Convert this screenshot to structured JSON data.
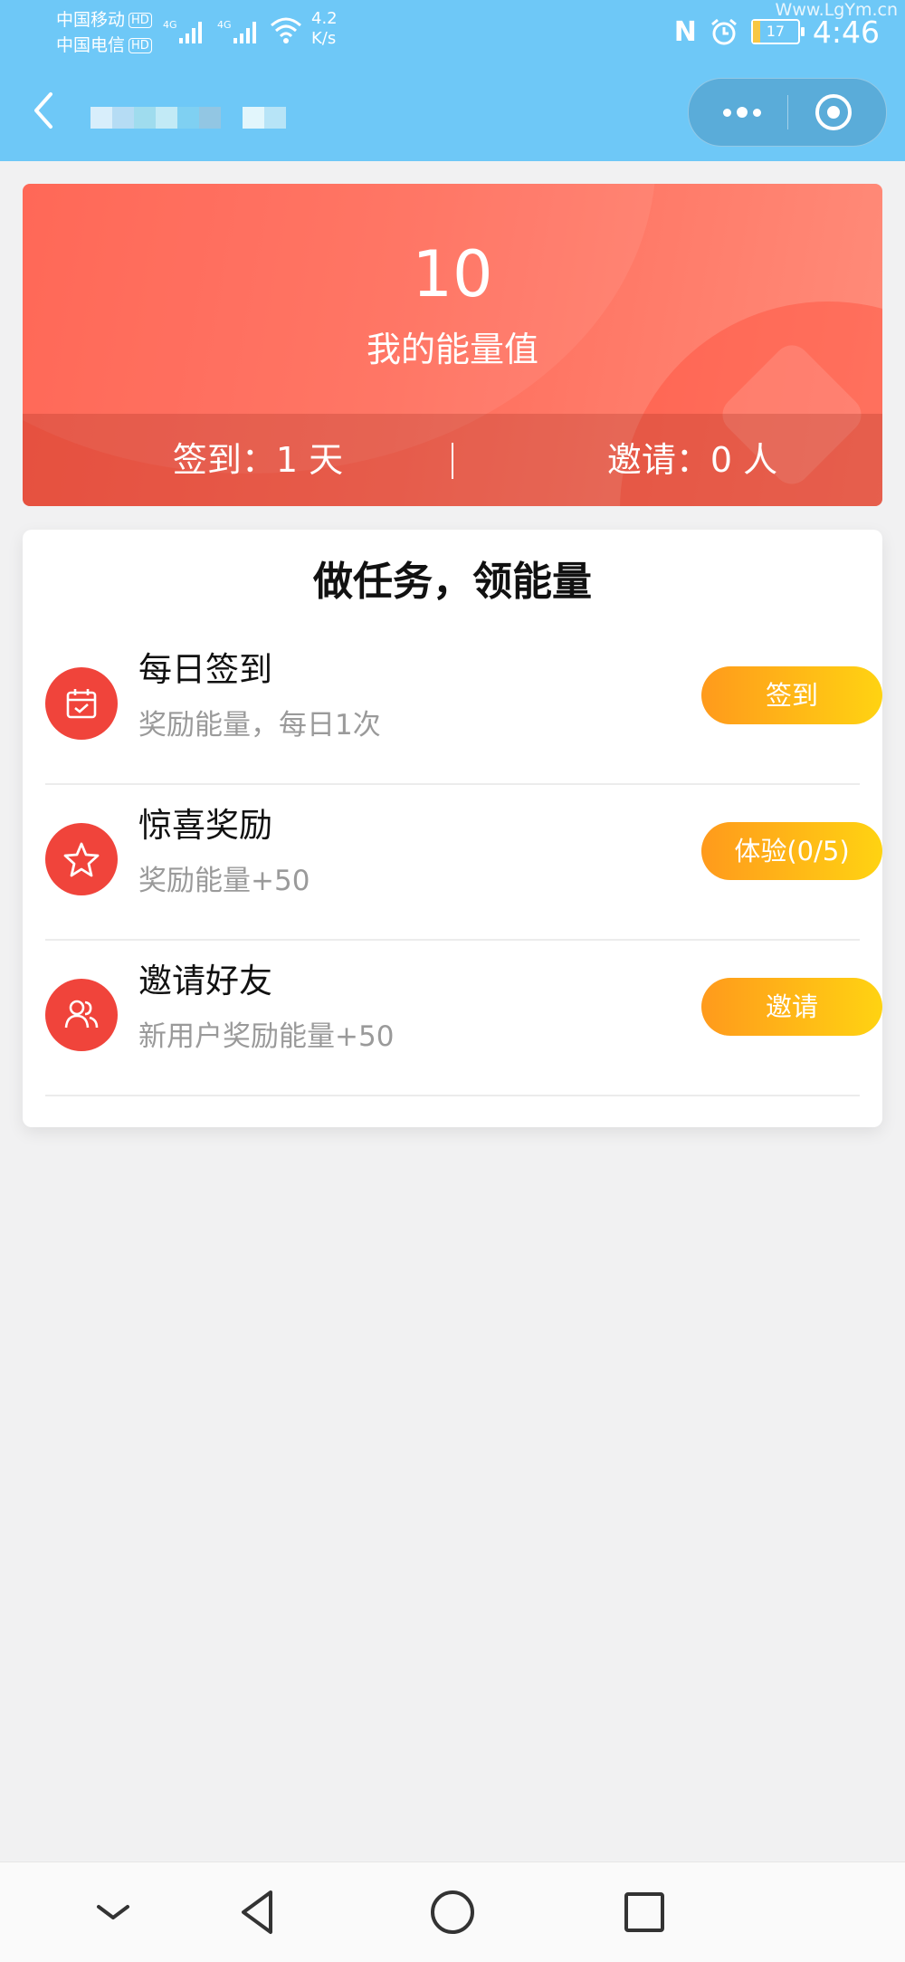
{
  "status_bar": {
    "carrier_1": "中国移动",
    "carrier_2": "中国电信",
    "hd_badge": "HD",
    "network": "4G",
    "speed_value": "4.2",
    "speed_unit": "K/s",
    "battery": "17",
    "battery_level": 0.17,
    "time": "4:46",
    "watermark": "Www.LgYm.cn"
  },
  "header": {
    "back_icon": "chevron-left-icon",
    "more_icon": "more-dots-icon",
    "close_icon": "target-circle-icon"
  },
  "energy": {
    "value": "10",
    "label": "我的能量值",
    "checkin_text": "签到：1 天",
    "invite_text": "邀请：0 人"
  },
  "tasks": {
    "title": "做任务，领能量",
    "items": [
      {
        "icon": "calendar-icon",
        "name": "每日签到",
        "desc": "奖励能量，每日1次",
        "button": "签到"
      },
      {
        "icon": "star-icon",
        "name": "惊喜奖励",
        "desc": "奖励能量+50",
        "button": "体验(0/5)"
      },
      {
        "icon": "users-icon",
        "name": "邀请好友",
        "desc": "新用户奖励能量+50",
        "button": "邀请"
      }
    ]
  },
  "colors": {
    "header_bg": "#6ec8f7",
    "energy_card": "#ff6d5b",
    "task_icon_bg": "#f0443b",
    "button_gradient_start": "#ff9a1c",
    "button_gradient_end": "#ffd312"
  }
}
